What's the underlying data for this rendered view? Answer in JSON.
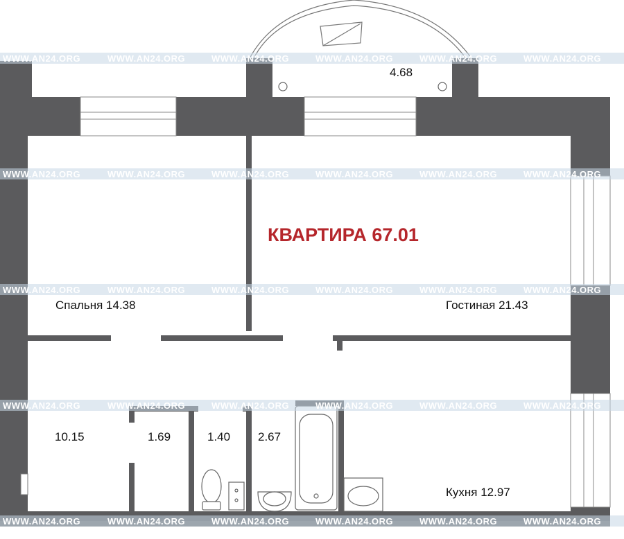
{
  "plan": {
    "title": "КВАРТИРА 67.01",
    "rooms": {
      "balcony": "4.68",
      "bedroom": "Спальня 14.38",
      "living": "Гостиная 21.43",
      "hall": "10.15",
      "closet": "1.69",
      "wc": "1.40",
      "bath": "2.67",
      "kitchen": "Кухня 12.97"
    },
    "watermark": "WWW.AN24.ORG"
  },
  "colors": {
    "wall": "#5b5b5d",
    "title": "#b5262b",
    "watermark_band": "#c7d7e6",
    "line": "#555555"
  }
}
